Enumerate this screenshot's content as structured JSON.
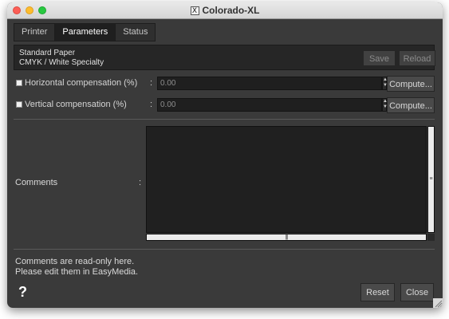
{
  "window": {
    "title": "Colorado-XL",
    "title_icon": "x11-icon"
  },
  "tabs": [
    {
      "label": "Printer",
      "active": false
    },
    {
      "label": "Parameters",
      "active": true
    },
    {
      "label": "Status",
      "active": false
    }
  ],
  "paper": {
    "line1": "Standard Paper",
    "line2": "CMYK / White Specialty",
    "save_label": "Save",
    "reload_label": "Reload"
  },
  "horizontal": {
    "label": "Horizontal compensation (%)",
    "separator": ":",
    "value": "0.00",
    "checked": false,
    "compute_label": "Compute..."
  },
  "vertical": {
    "label": "Vertical compensation (%)",
    "separator": ":",
    "value": "0.00",
    "checked": false,
    "compute_label": "Compute..."
  },
  "comments": {
    "label": "Comments",
    "separator": ":",
    "text": ""
  },
  "info": {
    "line1": "Comments are read-only here.",
    "line2": "Please edit them in EasyMedia."
  },
  "footer": {
    "help_label": "?",
    "reset_label": "Reset",
    "close_label": "Close"
  }
}
